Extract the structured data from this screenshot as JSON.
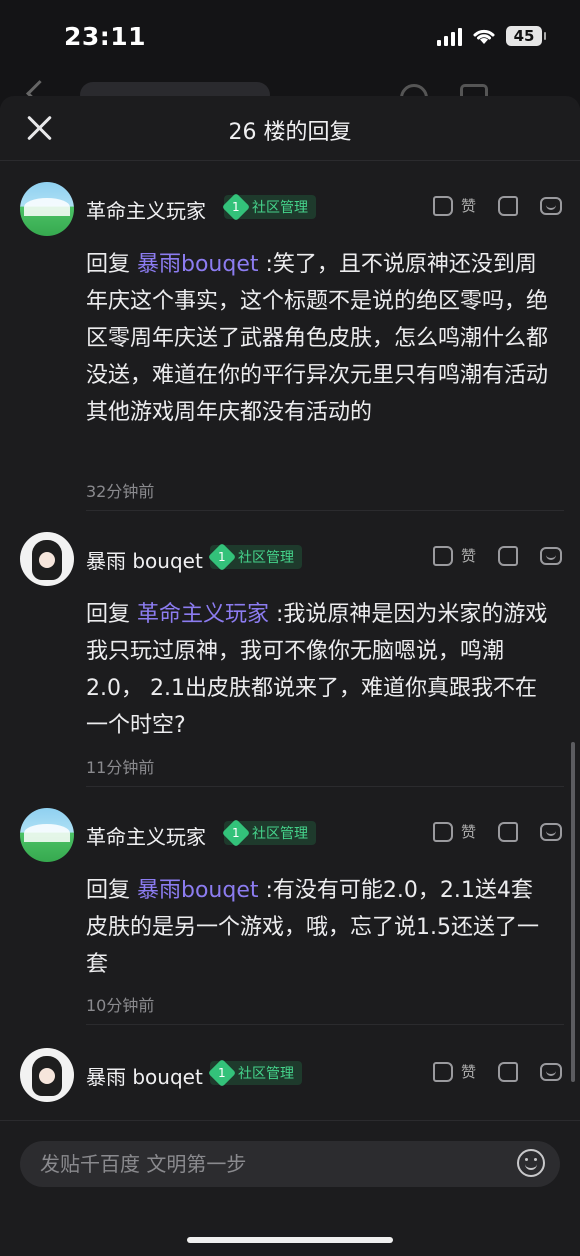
{
  "status_bar": {
    "time": "23:11",
    "battery": "45"
  },
  "sheet": {
    "title": "26 楼的回复"
  },
  "role_badge": "社区管理",
  "like_label": "赞",
  "replies": [
    {
      "username": "革命主义玩家",
      "level": "1",
      "reply_prefix": "回复 ",
      "mention": "暴雨bouqet",
      "text": " :笑了，且不说原神还没到周年庆这个事实，这个标题不是说的绝区零吗，绝区零周年庆送了武器角色皮肤，怎么鸣潮什么都没送，难道在你的平行异次元里只有鸣潮有活动其他游戏周年庆都没有活动的",
      "time": "32分钟前"
    },
    {
      "username": "暴雨 bouqet",
      "level": "1",
      "reply_prefix": "回复 ",
      "mention": "革命主义玩家",
      "text": " :我说原神是因为米家的游戏我只玩过原神，我可不像你无脑嗯说，鸣潮2.0， 2.1出皮肤都说来了，难道你真跟我不在一个时空?",
      "time": "11分钟前"
    },
    {
      "username": "革命主义玩家",
      "level": "1",
      "reply_prefix": "回复 ",
      "mention": "暴雨bouqet",
      "text": " :有没有可能2.0，2.1送4套皮肤的是另一个游戏，哦，忘了说1.5还送了一套",
      "time": "10分钟前"
    },
    {
      "username": "暴雨 bouqet",
      "level": "1"
    }
  ],
  "composer": {
    "placeholder": "发贴千百度 文明第一步"
  }
}
